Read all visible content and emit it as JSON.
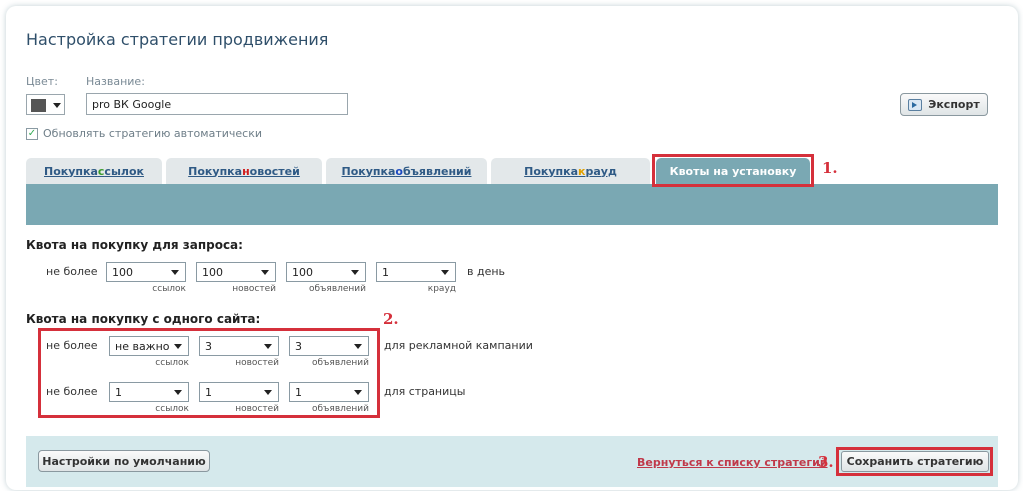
{
  "title": "Настройка стратегии продвижения",
  "color_label": "Цвет:",
  "name_label": "Название:",
  "name_value": "pro ВК Google",
  "export_label": "Экспорт",
  "auto_update_label": "Обновлять стратегию автоматически",
  "auto_update_checked": true,
  "tabs": [
    {
      "prefix": "Покупка ",
      "hl": "с",
      "rest": "сылок",
      "hl_color": "green"
    },
    {
      "prefix": "Покупка ",
      "hl": "н",
      "rest": "овостей",
      "hl_color": "red"
    },
    {
      "prefix": "Покупка ",
      "hl": "о",
      "rest": "бъявлений",
      "hl_color": "blue"
    },
    {
      "prefix": "Покупка ",
      "hl": "к",
      "rest": "рауд",
      "hl_color": "orange"
    },
    {
      "label": "Квоты на установку",
      "active": true
    }
  ],
  "markers": {
    "m1": "1.",
    "m2": "2.",
    "m3": "3."
  },
  "request_quota": {
    "heading": "Квота на покупку для запроса:",
    "prefix": "не более",
    "suffix": "в день",
    "fields": [
      {
        "value": "100",
        "caption": "ссылок"
      },
      {
        "value": "100",
        "caption": "новостей"
      },
      {
        "value": "100",
        "caption": "объявлений"
      },
      {
        "value": "1",
        "caption": "крауд"
      }
    ]
  },
  "site_quota": {
    "heading": "Квота на покупку с одного сайта:",
    "rows": [
      {
        "prefix": "не более",
        "suffix": "для рекламной кампании",
        "fields": [
          {
            "value": "не важно",
            "caption": "ссылок"
          },
          {
            "value": "3",
            "caption": "новостей"
          },
          {
            "value": "3",
            "caption": "объявлений"
          }
        ]
      },
      {
        "prefix": "не более",
        "suffix": "для страницы",
        "fields": [
          {
            "value": "1",
            "caption": "ссылок"
          },
          {
            "value": "1",
            "caption": "новостей"
          },
          {
            "value": "1",
            "caption": "объявлений"
          }
        ]
      }
    ]
  },
  "footer": {
    "default_label": "Настройки по умолчанию",
    "back_label": "Вернуться к списку стратегий",
    "save_label": "Сохранить стратегию"
  },
  "colors": {
    "accent": "#7aa8b3",
    "highlight": "#d5303b",
    "footer_bg": "#d5e9ec"
  }
}
